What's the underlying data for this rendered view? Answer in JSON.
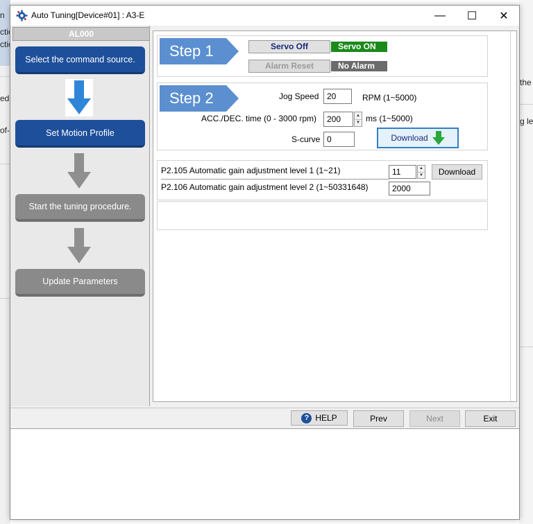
{
  "background": {
    "left_fragments": [
      "n",
      "ctic",
      "ctic",
      "ed",
      "of-"
    ],
    "right_fragments": [
      "the",
      "g le"
    ]
  },
  "window": {
    "title": "Auto Tuning[Device#01]  : A3-E",
    "minimize_glyph": "—",
    "maximize_glyph": "☐",
    "close_glyph": "✕"
  },
  "steps_panel": {
    "alarm_code": "AL000",
    "steps": [
      {
        "label": "Select the command source.",
        "state": "done"
      },
      {
        "label": "Set Motion Profile",
        "state": "active"
      },
      {
        "label": "Start the tuning procedure.",
        "state": "pending"
      },
      {
        "label": "Update Parameters",
        "state": "pending"
      }
    ]
  },
  "step1": {
    "label": "Step 1",
    "servo_off_label": "Servo Off",
    "servo_status": "Servo ON",
    "alarm_reset_label": "Alarm Reset",
    "alarm_status": "No Alarm"
  },
  "step2": {
    "label": "Step 2",
    "jog_speed_label": "Jog Speed",
    "jog_speed_value": "20",
    "jog_speed_unit": "RPM (1~5000)",
    "acc_label": "ACC./DEC. time (0 - 3000 rpm)",
    "acc_value": "200",
    "acc_unit": "ms (1~5000)",
    "scurve_label": "S-curve",
    "scurve_value": "0",
    "download_label": "Download"
  },
  "params": [
    {
      "label": "P2.105 Automatic gain adjustment level 1 (1~21)",
      "value": "11"
    },
    {
      "label": "P2.106 Automatic gain adjustment level 2 (1~50331648)",
      "value": "2000"
    }
  ],
  "params_download_label": "Download",
  "footer": {
    "help_label": "HELP",
    "prev_label": "Prev",
    "next_label": "Next",
    "exit_label": "Exit"
  },
  "colors": {
    "step_blue": "#1e4f9a",
    "step_tab": "#5b8fd0",
    "servo_on": "#1a8a1a",
    "no_alarm": "#6b6b6b",
    "arrow_blue": "#2f86d8",
    "arrow_gray": "#8f8f8f"
  }
}
